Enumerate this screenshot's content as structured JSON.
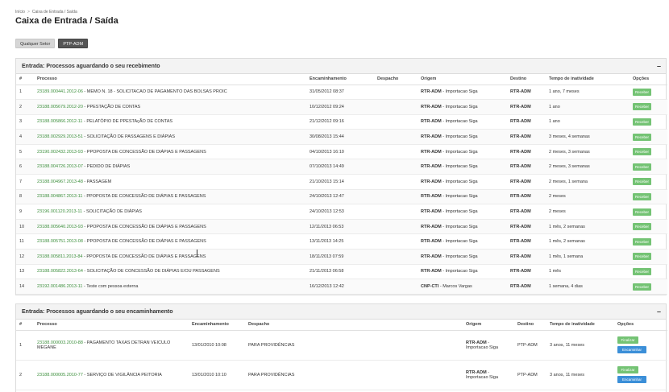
{
  "breadcrumb": {
    "items": [
      "Início",
      "Caixa de Entrada / Saída"
    ],
    "separator": ">"
  },
  "page": {
    "title": "Caixa de Entrada / Saída"
  },
  "sectors": [
    {
      "label": "Qualquer Setor",
      "active": false
    },
    {
      "label": "PTP-ADM",
      "active": true
    }
  ],
  "panel_receive": {
    "title": "Entrada: Processos aguardando o seu recebimento",
    "collapse_symbol": "–",
    "columns": [
      "#",
      "Processo",
      "Encaminhamento",
      "Despacho",
      "Origem",
      "Destino",
      "Tempo de inatividade",
      "Opções"
    ],
    "rows": [
      {
        "num": "1",
        "process_id": "23189.000441.2012-06",
        "process_desc": "MEMO N. 18 - SOLICITACAO DE PAGAMENTO DAS BOLSAS PROIC",
        "forwarded": "31/05/2012 08:37",
        "dispatch": "",
        "origin_code": "RTR-ADM",
        "origin_desc": "Importacao Siga",
        "dest": "RTR-ADM",
        "idle": "1 ano, 7 meses",
        "action": "Receber"
      },
      {
        "num": "2",
        "process_id": "23188.005679.2012-20",
        "process_desc": "PPESTAÇÃO DE CONTAS",
        "forwarded": "10/12/2012 09:24",
        "dispatch": "",
        "origin_code": "RTR-ADM",
        "origin_desc": "Importacao Siga",
        "dest": "RTR-ADM",
        "idle": "1 ano",
        "action": "Receber"
      },
      {
        "num": "3",
        "process_id": "23188.005866.2012-11",
        "process_desc": "PELATÓPIO DE PPESTAçÃO DE CONTAS",
        "forwarded": "21/12/2012 09:16",
        "dispatch": "",
        "origin_code": "RTR-ADM",
        "origin_desc": "Importacao Siga",
        "dest": "RTR-ADM",
        "idle": "1 ano",
        "action": "Receber"
      },
      {
        "num": "4",
        "process_id": "23188.002929.2013-51",
        "process_desc": "SOLICITAÇÃO DE PASSAGENS E DIÁPIAS",
        "forwarded": "30/08/2013 15:44",
        "dispatch": "",
        "origin_code": "RTR-ADM",
        "origin_desc": "Importacao Siga",
        "dest": "RTR-ADM",
        "idle": "3 meses, 4 semanas",
        "action": "Receber"
      },
      {
        "num": "5",
        "process_id": "23190.002432.2013-93",
        "process_desc": "PPOPOSTA DE CONCESSÃO DE DIÁPIAS E PASSAGENS",
        "forwarded": "04/10/2013 16:10",
        "dispatch": "",
        "origin_code": "RTR-ADM",
        "origin_desc": "Importacao Siga",
        "dest": "RTR-ADM",
        "idle": "2 meses, 3 semanas",
        "action": "Receber"
      },
      {
        "num": "6",
        "process_id": "23188.004726.2013-07",
        "process_desc": "PEDIDO DE DIÁPIAS",
        "forwarded": "07/10/2013 14:49",
        "dispatch": "",
        "origin_code": "RTR-ADM",
        "origin_desc": "Importacao Siga",
        "dest": "RTR-ADM",
        "idle": "2 meses, 3 semanas",
        "action": "Receber"
      },
      {
        "num": "7",
        "process_id": "23188.004967.2013-48",
        "process_desc": "PASSAGEM",
        "forwarded": "21/10/2013 15:14",
        "dispatch": "",
        "origin_code": "RTR-ADM",
        "origin_desc": "Importacao Siga",
        "dest": "RTR-ADM",
        "idle": "2 meses, 1 semana",
        "action": "Receber"
      },
      {
        "num": "8",
        "process_id": "23188.004867.2013-11",
        "process_desc": "PPOPOSTA DE CONCESSÃO DE DIÁPIAS E PASSAGENS",
        "forwarded": "24/10/2013 12:47",
        "dispatch": "",
        "origin_code": "RTR-ADM",
        "origin_desc": "Importacao Siga",
        "dest": "RTR-ADM",
        "idle": "2 meses",
        "action": "Receber"
      },
      {
        "num": "9",
        "process_id": "23196.001120.2013-11",
        "process_desc": "SOLICITAÇÃO DE DIÁPIAS",
        "forwarded": "24/10/2013 12:53",
        "dispatch": "",
        "origin_code": "RTR-ADM",
        "origin_desc": "Importacao Siga",
        "dest": "RTR-ADM",
        "idle": "2 meses",
        "action": "Receber"
      },
      {
        "num": "10",
        "process_id": "23188.005640.2013-93",
        "process_desc": "PPOPOSTA DE CONCESSÃO DE DIÁPIAS E PASSAGENS",
        "forwarded": "12/11/2013 06:53",
        "dispatch": "",
        "origin_code": "RTR-ADM",
        "origin_desc": "Importacao Siga",
        "dest": "RTR-ADM",
        "idle": "1 mês, 2 semanas",
        "action": "Receber"
      },
      {
        "num": "11",
        "process_id": "23188.005751.2013-08",
        "process_desc": "PPOPOSTA DE CONCESSÃO DE DIÁPIAS E PASSAGENS",
        "forwarded": "13/11/2013 14:25",
        "dispatch": "",
        "origin_code": "RTR-ADM",
        "origin_desc": "Importacao Siga",
        "dest": "RTR-ADM",
        "idle": "1 mês, 2 semanas",
        "action": "Receber"
      },
      {
        "num": "12",
        "process_id": "23188.005811.2013-84",
        "process_desc": "PPOPOSTA DE CONCESSÃO DE DIÁPIAS E PASSAGENS",
        "forwarded": "18/11/2013 07:59",
        "dispatch": "",
        "origin_code": "RTR-ADM",
        "origin_desc": "Importacao Siga",
        "dest": "RTR-ADM",
        "idle": "1 mês, 1 semana",
        "action": "Receber"
      },
      {
        "num": "13",
        "process_id": "23188.005822.2013-64",
        "process_desc": "SOLICITAÇÃO DE CONCESSÃO DE DIÁPIAS E/OU PASSAGENS",
        "forwarded": "21/11/2013 06:58",
        "dispatch": "",
        "origin_code": "RTR-ADM",
        "origin_desc": "Importacao Siga",
        "dest": "RTR-ADM",
        "idle": "1 mês",
        "action": "Receber"
      },
      {
        "num": "14",
        "process_id": "23192.001486.2013-11",
        "process_desc": "Teste com pessoa externa",
        "forwarded": "16/12/2013 12:42",
        "dispatch": "",
        "origin_code": "CNP-CTI",
        "origin_desc": "Marcos Vargas",
        "dest": "RTR-ADM",
        "idle": "1 semana, 4 dias",
        "action": "Receber"
      }
    ]
  },
  "panel_forward": {
    "title": "Entrada: Processos aguardando o seu encaminhamento",
    "collapse_symbol": "–",
    "columns": [
      "#",
      "Processo",
      "Encaminhamento",
      "Despacho",
      "Origem",
      "Destino",
      "Tempo de inatividade",
      "Opções"
    ],
    "rows": [
      {
        "num": "1",
        "process_id": "23188.000003.2010-88",
        "process_desc": "PAGAMENTO TAXAS DETRAN VEICULO MEGANE",
        "forwarded": "13/01/2010 10:08",
        "dispatch": "PARA PROVIDÊNCIAS",
        "origin_code": "RTR-ADM",
        "origin_desc": "Importacao Siga",
        "dest": "PTP-ADM",
        "idle": "3 anos, 11 meses",
        "finalize": "Finalizar",
        "forward": "Encaminhar"
      },
      {
        "num": "2",
        "process_id": "23188.000005.2010-77",
        "process_desc": "SERVIÇO DE VIGILÂNCIA PEITORIA",
        "forwarded": "13/01/2010 10:10",
        "dispatch": "PARA PROVIDÊNCIAS",
        "origin_code": "RTR-ADM",
        "origin_desc": "Importacao Siga",
        "dest": "PTP-ADM",
        "idle": "3 anos, 11 meses",
        "finalize": "Finalizar",
        "forward": "Encaminhar"
      }
    ]
  }
}
